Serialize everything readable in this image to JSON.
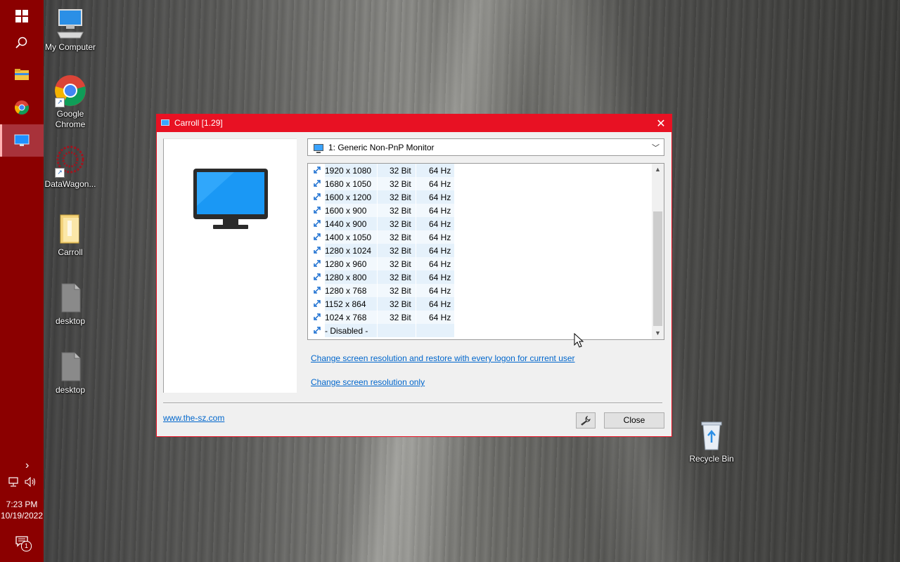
{
  "taskbar": {
    "time": "7:23 PM",
    "date": "10/19/2022",
    "notification_count": "1",
    "show_more_glyph": "›"
  },
  "desktop_icons": {
    "my_computer": "My Computer",
    "google_chrome": "Google Chrome",
    "datawagon": "DataWagon...",
    "carroll": "Carroll",
    "desktop_1": "desktop",
    "desktop_2": "desktop",
    "recycle_bin": "Recycle Bin"
  },
  "window": {
    "title": "Carroll [1.29]",
    "close_glyph": "✕",
    "monitor_select": {
      "value": "1: Generic Non-PnP Monitor"
    },
    "resolutions": [
      {
        "res": "1920 x 1080",
        "bits": "32 Bit",
        "hz": "64 Hz"
      },
      {
        "res": "1680 x 1050",
        "bits": "32 Bit",
        "hz": "64 Hz"
      },
      {
        "res": "1600 x 1200",
        "bits": "32 Bit",
        "hz": "64 Hz"
      },
      {
        "res": "1600 x 900",
        "bits": "32 Bit",
        "hz": "64 Hz"
      },
      {
        "res": "1440 x 900",
        "bits": "32 Bit",
        "hz": "64 Hz"
      },
      {
        "res": "1400 x 1050",
        "bits": "32 Bit",
        "hz": "64 Hz"
      },
      {
        "res": "1280 x 1024",
        "bits": "32 Bit",
        "hz": "64 Hz"
      },
      {
        "res": "1280 x 960",
        "bits": "32 Bit",
        "hz": "64 Hz"
      },
      {
        "res": "1280 x 800",
        "bits": "32 Bit",
        "hz": "64 Hz"
      },
      {
        "res": "1280 x 768",
        "bits": "32 Bit",
        "hz": "64 Hz"
      },
      {
        "res": "1152 x 864",
        "bits": "32 Bit",
        "hz": "64 Hz"
      },
      {
        "res": "1024 x 768",
        "bits": "32 Bit",
        "hz": "64 Hz"
      },
      {
        "res": "- Disabled -",
        "bits": "",
        "hz": ""
      }
    ],
    "link_restore": "Change screen resolution and restore with every logon for current user",
    "link_only": "Change screen resolution only",
    "website": "www.the-sz.com",
    "close_button": "Close"
  },
  "colors": {
    "taskbar": "#8b0000",
    "title_bar": "#e81123",
    "link": "#0066cc",
    "row_highlight": "#e5f1fb"
  }
}
